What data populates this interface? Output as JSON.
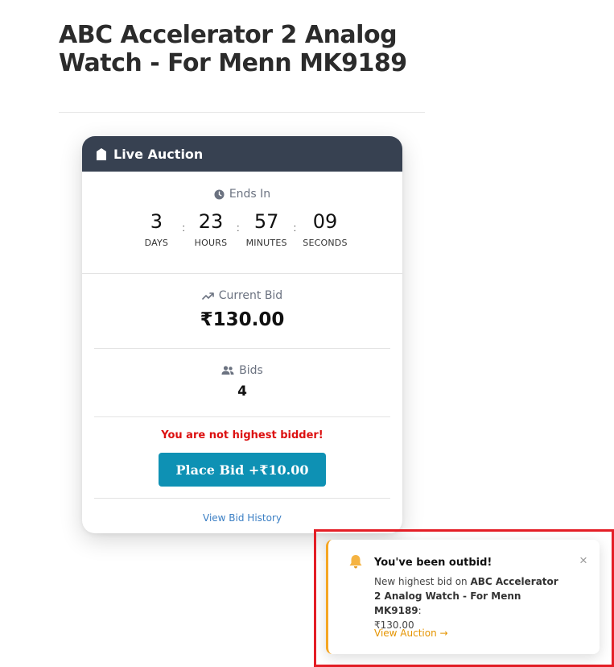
{
  "product": {
    "title": "ABC Accelerator 2 Analog Watch - For Menn MK9189"
  },
  "auction": {
    "header_label": "Live Auction",
    "ends_in_label": "Ends In",
    "countdown": [
      {
        "value": "3",
        "label": "DAYS"
      },
      {
        "value": "23",
        "label": "HOURS"
      },
      {
        "value": "57",
        "label": "MINUTES"
      },
      {
        "value": "09",
        "label": "SECONDS"
      }
    ],
    "separator": ":",
    "current_bid_label": "Current Bid",
    "current_bid_value": "₹130.00",
    "bids_label": "Bids",
    "bids_count": "4",
    "status_message": "You are not highest bidder!",
    "place_bid_label": "Place Bid +₹10.00",
    "history_link_label": "View Bid History"
  },
  "notification": {
    "title": "You've been outbid!",
    "body_prefix": "New highest bid on ",
    "body_product": "ABC Accelerator 2 Analog Watch - For Menn MK9189",
    "body_suffix": ":",
    "body_amount": "₹130.00",
    "link_label": "View Auction →",
    "close_glyph": "×"
  },
  "colors": {
    "header_bg": "#374151",
    "button_bg": "#0e91b4",
    "warning_text": "#dc1010",
    "toast_accent": "#f5a623",
    "highlight_frame": "#e41e26"
  }
}
